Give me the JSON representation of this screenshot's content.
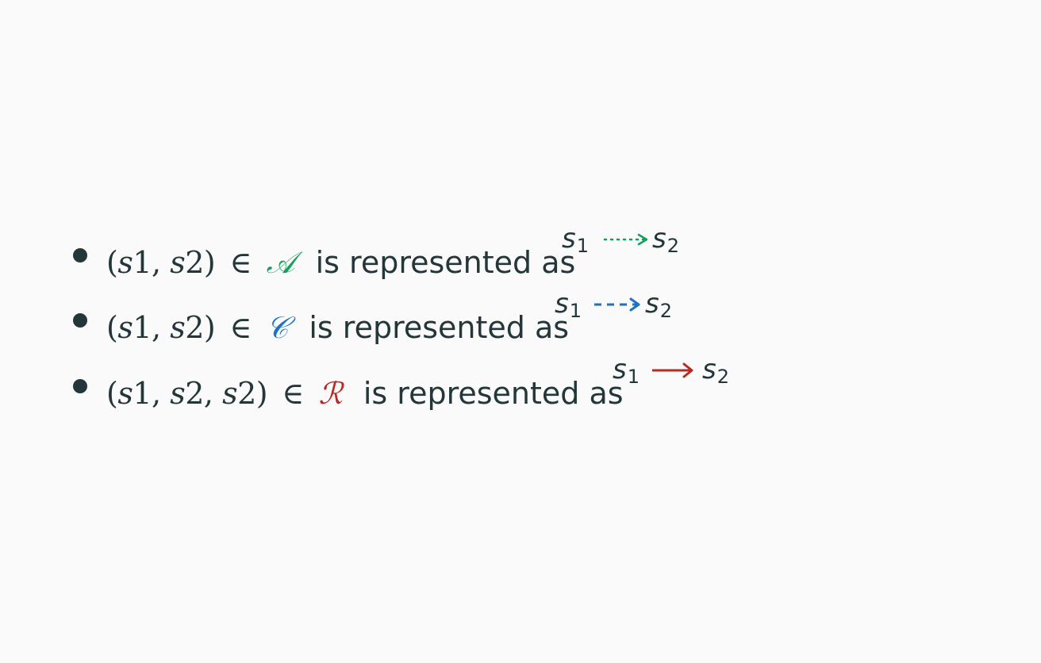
{
  "items": [
    {
      "tuple": [
        "s",
        "1",
        ", ",
        "s",
        "2"
      ],
      "member_symbol": "∈",
      "set_symbol": "𝒜",
      "text": "is represented as",
      "source_var": "s",
      "source_sub": "1",
      "target_var": "s",
      "target_sub": "2",
      "arrow_style": "dotted",
      "color": "#14a05a"
    },
    {
      "tuple": [
        "s",
        "1",
        ", ",
        "s",
        "2"
      ],
      "member_symbol": "∈",
      "set_symbol": "𝒞",
      "text": "is represented as",
      "source_var": "s",
      "source_sub": "1",
      "target_var": "s",
      "target_sub": "2",
      "arrow_style": "dashed",
      "color": "#1a73c9"
    },
    {
      "tuple": [
        "s",
        "1",
        ", ",
        "s",
        "2",
        ", ",
        "s",
        "2"
      ],
      "member_symbol": "∈",
      "set_symbol": "ℛ",
      "text": "is represented as",
      "source_var": "s",
      "source_sub": "1",
      "target_var": "s",
      "target_sub": "2",
      "arrow_style": "solid",
      "color": "#b62a24"
    }
  ]
}
